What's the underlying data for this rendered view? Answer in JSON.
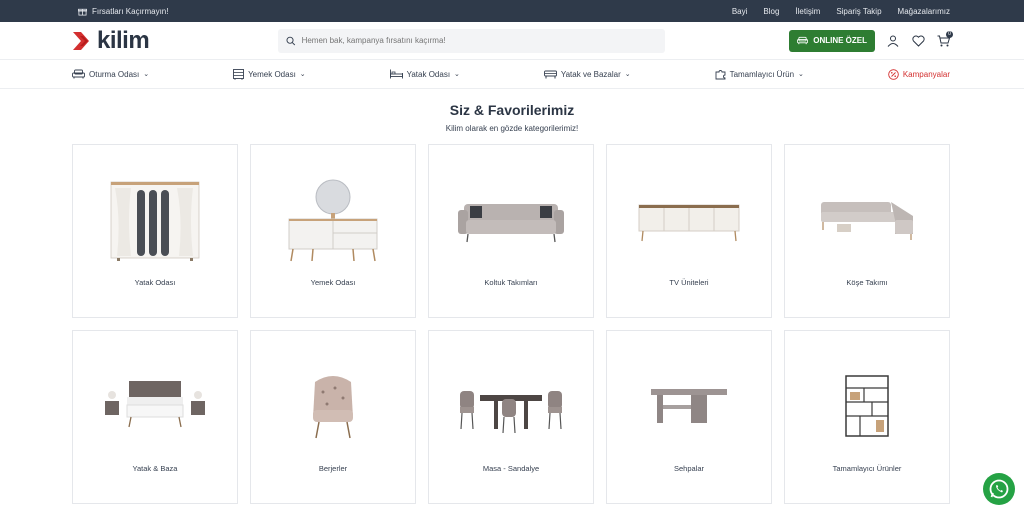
{
  "topbar": {
    "promo": "Fırsatları Kaçırmayın!",
    "links": [
      "Bayi",
      "Blog",
      "İletişim",
      "Sipariş Takip",
      "Mağazalarımız"
    ]
  },
  "header": {
    "logo": "kilim",
    "search_placeholder": "Hemen bak, kampanya fırsatını kaçırma!",
    "online_button": "ONLINE ÖZEL",
    "cart_count": "0"
  },
  "nav": {
    "items": [
      "Oturma Odası",
      "Yemek Odası",
      "Yatak Odası",
      "Yatak ve Bazalar",
      "Tamamlayıcı Ürün"
    ],
    "campaign": "Kampanyalar"
  },
  "section": {
    "title": "Siz & Favorilerimiz",
    "subtitle": "Kilim olarak en gözde kategorilerimiz!"
  },
  "categories": [
    {
      "label": "Yatak Odası",
      "icon": "wardrobe-image"
    },
    {
      "label": "Yemek Odası",
      "icon": "sideboard-image"
    },
    {
      "label": "Koltuk Takımları",
      "icon": "sofa-image"
    },
    {
      "label": "TV Üniteleri",
      "icon": "tv-unit-image"
    },
    {
      "label": "Köşe Takımı",
      "icon": "corner-sofa-image"
    },
    {
      "label": "Yatak & Baza",
      "icon": "bed-image"
    },
    {
      "label": "Berjerler",
      "icon": "armchair-image"
    },
    {
      "label": "Masa - Sandalye",
      "icon": "dining-set-image"
    },
    {
      "label": "Sehpalar",
      "icon": "coffee-table-image"
    },
    {
      "label": "Tamamlayıcı Ürünler",
      "icon": "shelf-image"
    }
  ],
  "colors": {
    "topbar": "#2f3a4a",
    "brand_red": "#d32f2f",
    "online_green": "#2e7d32",
    "whatsapp": "#25a244"
  }
}
